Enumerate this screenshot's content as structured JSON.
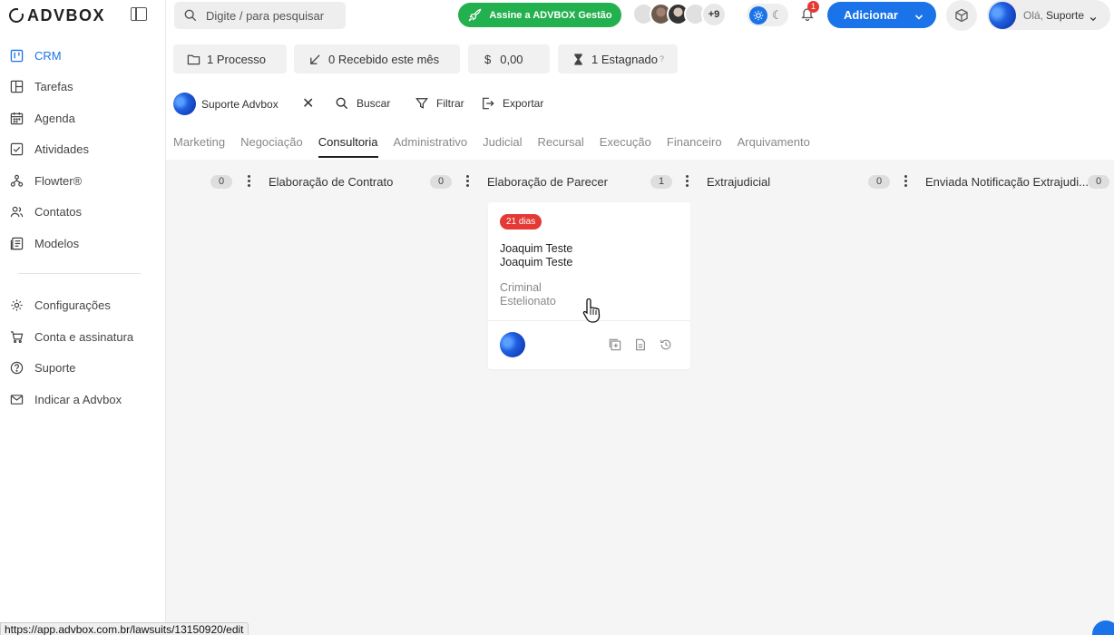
{
  "brand": {
    "name": "ADVBOX"
  },
  "sidebar": {
    "items": [
      {
        "label": "CRM",
        "icon": "crm-icon",
        "active": true
      },
      {
        "label": "Tarefas",
        "icon": "tasks-icon"
      },
      {
        "label": "Agenda",
        "icon": "calendar-icon"
      },
      {
        "label": "Atividades",
        "icon": "activities-icon"
      },
      {
        "label": "Flowter®",
        "icon": "flow-icon"
      },
      {
        "label": "Contatos",
        "icon": "contacts-icon"
      },
      {
        "label": "Modelos",
        "icon": "templates-icon"
      }
    ],
    "bottom_items": [
      {
        "label": "Configurações",
        "icon": "gear-icon"
      },
      {
        "label": "Conta e assinatura",
        "icon": "cart-icon"
      },
      {
        "label": "Suporte",
        "icon": "help-icon"
      },
      {
        "label": "Indicar a Advbox",
        "icon": "mail-icon"
      }
    ]
  },
  "header": {
    "search_placeholder": "Digite / para pesquisar",
    "promo_label": "Assine a ADVBOX Gestão",
    "avatars_more": "+9",
    "notifications_count": "1",
    "add_label": "Adicionar",
    "greeting": "Olá,",
    "user_name": "Suporte"
  },
  "stats": {
    "processes": "1 Processo",
    "received": "0 Recebido este mês",
    "amount_symbol": "$",
    "amount": "0,00",
    "stagnant": "1 Estagnado",
    "stagnant_help": "?"
  },
  "filters": {
    "user": "Suporte Advbox",
    "search": "Buscar",
    "filter": "Filtrar",
    "export": "Exportar"
  },
  "tabs": [
    "Marketing",
    "Negociação",
    "Consultoria",
    "Administrativo",
    "Judicial",
    "Recursal",
    "Execução",
    "Financeiro",
    "Arquivamento"
  ],
  "active_tab": "Consultoria",
  "columns": [
    {
      "title": "",
      "count": "0"
    },
    {
      "title": "Elaboração de Contrato",
      "count": "0"
    },
    {
      "title": "Elaboração de Parecer",
      "count": "1"
    },
    {
      "title": "Extrajudicial",
      "count": "0"
    },
    {
      "title": "Enviada Notificação Extrajudi...",
      "count": "0"
    }
  ],
  "card": {
    "days": "21 dias",
    "client": "Joaquim Teste",
    "title": "Joaquim Teste",
    "area": "Criminal",
    "subject": "Estelionato"
  },
  "status_url": "https://app.advbox.com.br/lawsuits/13150920/edit",
  "colors": {
    "accent": "#1a73e8",
    "promo": "#23b04e",
    "danger": "#e53935"
  }
}
